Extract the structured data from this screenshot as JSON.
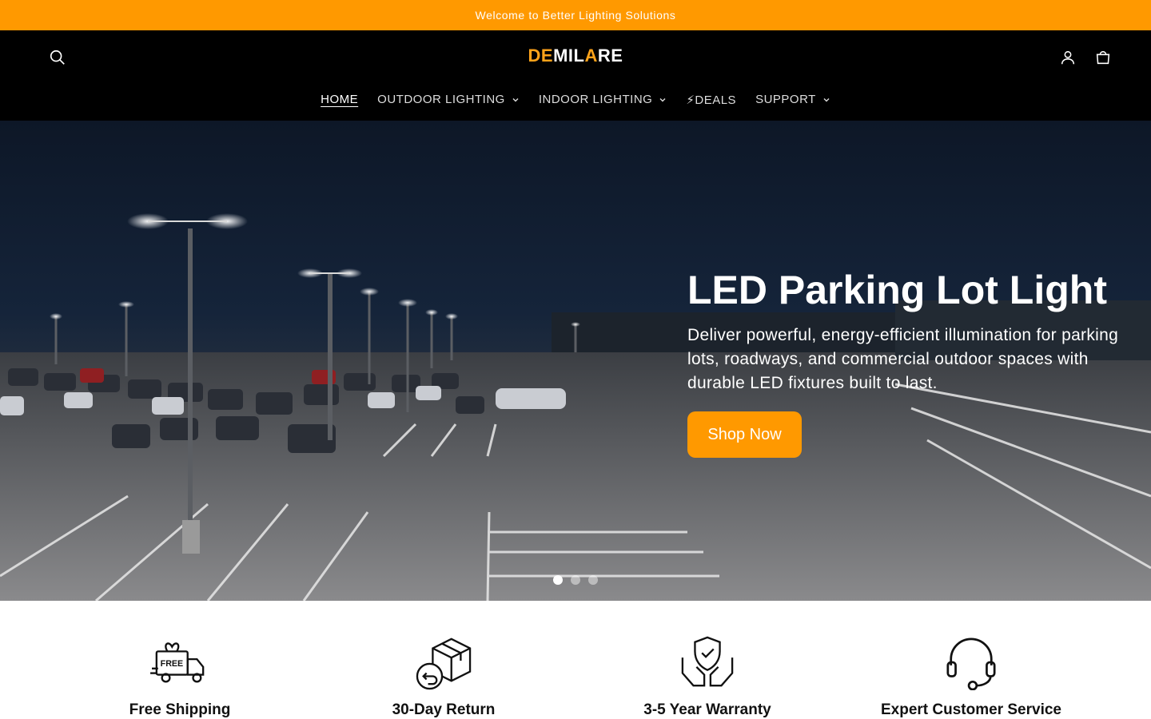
{
  "announcement": "Welcome to Better Lighting Solutions",
  "brand": {
    "part1": "DE",
    "part2": "MIL",
    "part3": "A",
    "part4": "RE",
    "accent": "#ff9900"
  },
  "header": {
    "search_icon": "search-icon",
    "account_icon": "account-icon",
    "cart_icon": "cart-icon"
  },
  "nav": {
    "items": [
      {
        "label": "HOME",
        "active": true
      },
      {
        "label": "OUTDOOR LIGHTING",
        "dropdown": true
      },
      {
        "label": "INDOOR LIGHTING",
        "dropdown": true
      },
      {
        "label": "⚡DEALS"
      },
      {
        "label": "SUPPORT",
        "dropdown": true
      }
    ]
  },
  "hero": {
    "title": "LED Parking Lot Light",
    "subtitle": "Deliver powerful, energy-efficient illumination for parking lots, roadways, and commercial outdoor spaces with durable LED fixtures built to last.",
    "cta": "Shop Now",
    "slides": 3,
    "active_slide": 1
  },
  "features": [
    {
      "label": "Free Shipping",
      "icon": "free-shipping-truck-icon"
    },
    {
      "label": "30-Day Return",
      "icon": "return-box-icon"
    },
    {
      "label": "3-5 Year Warranty",
      "icon": "warranty-shield-icon"
    },
    {
      "label": "Expert Customer Service",
      "icon": "headset-icon"
    }
  ]
}
